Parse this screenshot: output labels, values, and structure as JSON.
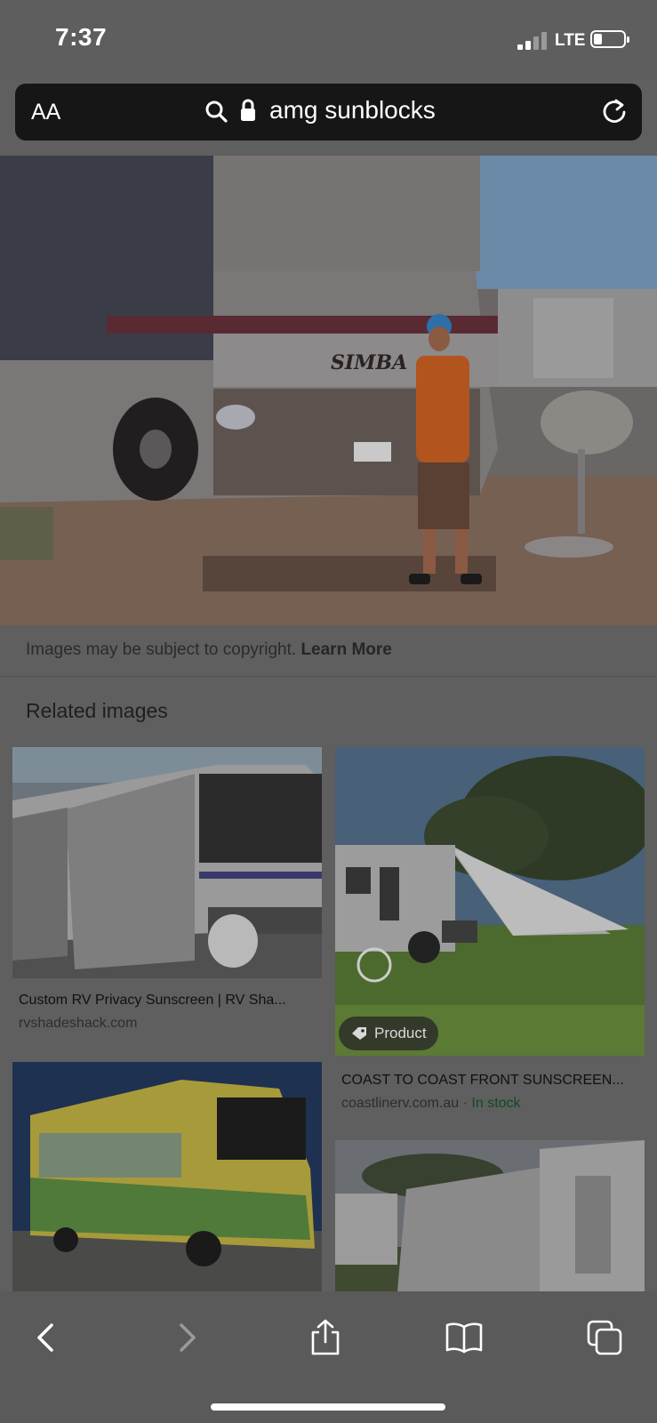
{
  "status_bar": {
    "time": "7:37",
    "network": "LTE"
  },
  "url_bar": {
    "text_size_button": "AA",
    "query": "amg sunblocks"
  },
  "hero_image": {
    "alt_text": "SIMBA"
  },
  "copyright": {
    "text": "Images may be subject to copyright.",
    "link": "Learn More"
  },
  "related": {
    "heading": "Related images",
    "items": [
      {
        "title": "Custom RV Privacy Sunscreen | RV Sha...",
        "domain": "rvshadeshack.com"
      },
      {
        "title": "COAST TO COAST FRONT SUNSCREEN...",
        "domain": "coastlinerv.com.au",
        "separator": " · ",
        "availability": "In stock",
        "badge": "Product"
      }
    ]
  },
  "toolbar": {
    "buttons": [
      "back",
      "forward",
      "share",
      "bookmarks",
      "tabs"
    ]
  },
  "colors": {
    "accent_instock": "#0f4b22",
    "url_bar_bg": "#161616"
  }
}
